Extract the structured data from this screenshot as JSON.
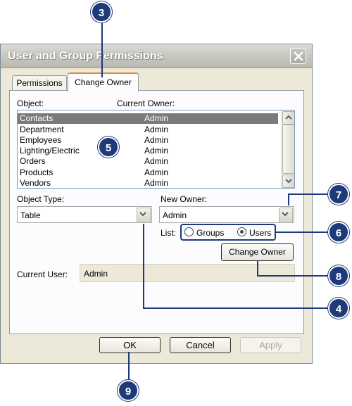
{
  "window": {
    "title": "User and Group Permissions"
  },
  "tabs": [
    {
      "label": "Permissions",
      "active": false
    },
    {
      "label": "Change Owner",
      "active": true
    }
  ],
  "object_list": {
    "header_object": "Object:",
    "header_owner": "Current Owner:",
    "rows": [
      {
        "object": "Contacts",
        "owner": "Admin",
        "selected": true
      },
      {
        "object": "Department",
        "owner": "Admin"
      },
      {
        "object": "Employees",
        "owner": "Admin"
      },
      {
        "object": "Lighting/Electric",
        "owner": "Admin"
      },
      {
        "object": "Orders",
        "owner": "Admin"
      },
      {
        "object": "Products",
        "owner": "Admin"
      },
      {
        "object": "Vendors",
        "owner": "Admin"
      }
    ]
  },
  "object_type": {
    "label": "Object Type:",
    "value": "Table"
  },
  "new_owner": {
    "label": "New Owner:",
    "value": "Admin"
  },
  "list_filter": {
    "label": "List:",
    "options": [
      {
        "label": "Groups",
        "selected": false
      },
      {
        "label": "Users",
        "selected": true
      }
    ]
  },
  "change_owner_button": "Change Owner",
  "current_user": {
    "label": "Current User:",
    "value": "Admin"
  },
  "buttons": {
    "ok": "OK",
    "cancel": "Cancel",
    "apply": "Apply"
  },
  "callouts": [
    "3",
    "5",
    "7",
    "6",
    "8",
    "4",
    "9"
  ],
  "colors": {
    "callout": "#1f3a78",
    "selection": "#7a7a7a",
    "dialog_bg": "#ece9d8",
    "active_tab_accent": "#e68b2c"
  }
}
